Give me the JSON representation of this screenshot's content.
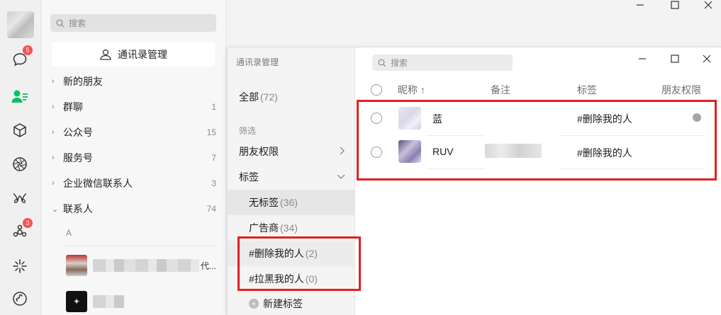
{
  "rail": {
    "badges": {
      "chat": "5",
      "moments": "3"
    }
  },
  "contacts_panel": {
    "search_placeholder": "搜索",
    "manage_button": "通讯录管理",
    "groups": [
      {
        "label": "新的朋友",
        "count": "",
        "arrow": "›"
      },
      {
        "label": "群聊",
        "count": "1",
        "arrow": "›"
      },
      {
        "label": "公众号",
        "count": "15",
        "arrow": "›"
      },
      {
        "label": "服务号",
        "count": "7",
        "arrow": "›"
      },
      {
        "label": "企业微信联系人",
        "count": "3",
        "arrow": "›"
      },
      {
        "label": "联系人",
        "count": "74",
        "arrow": "⌄"
      }
    ],
    "letter": "A",
    "friend_tail": "代..."
  },
  "dialog": {
    "title": "通讯录管理",
    "search_placeholder": "搜索",
    "sidebar": {
      "all_label": "全部",
      "all_count": "(72)",
      "filter_label": "筛选",
      "friend_perm": "朋友权限",
      "tags": "标签",
      "tag_items": [
        {
          "label": "无标签",
          "count": "(36)"
        },
        {
          "label": "广告商",
          "count": "(34)"
        },
        {
          "label": "#删除我的人",
          "count": "(2)"
        },
        {
          "label": "#拉黑我的人",
          "count": "(0)"
        }
      ],
      "new_tag": "新建标签"
    },
    "table": {
      "headers": {
        "nickname": "昵称 ↑",
        "remark": "备注",
        "tag": "标签",
        "permission": "朋友权限"
      },
      "rows": [
        {
          "nickname": "蓝",
          "tag": "#删除我的人"
        },
        {
          "nickname": "RUV",
          "tag": "#删除我的人"
        }
      ]
    }
  },
  "colors": {
    "accent_green": "#07c160",
    "badge_red": "#fa5151",
    "highlight_red": "#e02020"
  }
}
